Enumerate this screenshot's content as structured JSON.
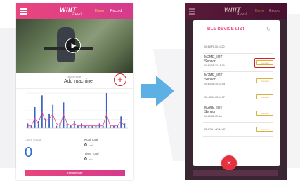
{
  "left_screen": {
    "header": {
      "logo": "WIIIT",
      "logo_sub": "Sport",
      "tab_active": "Home",
      "tab_other": "Record"
    },
    "machine_bar": {
      "label_small": "Device name",
      "label": "Add machine",
      "add_symbol": "+"
    },
    "chart_data": {
      "type": "bar",
      "values": [
        2,
        1,
        9,
        3,
        14,
        4,
        6,
        10,
        1,
        2,
        11,
        2,
        1,
        3,
        1,
        2,
        1,
        1,
        1,
        1,
        2,
        1,
        15,
        1,
        1,
        1,
        5,
        2
      ],
      "line_values": [
        1,
        1,
        4,
        2,
        7,
        3,
        4,
        6,
        2,
        1,
        6,
        2,
        1,
        2,
        1,
        1,
        1,
        1,
        1,
        1,
        1,
        1,
        6,
        1,
        1,
        1,
        3,
        1
      ],
      "colors": {
        "bar": "#3a63c8",
        "line": "#e8467f",
        "grid": "#e6e6e6"
      }
    },
    "stats": {
      "left_title": "Count TOTAL",
      "left_value": "0",
      "right_title_1": "Kcal Total",
      "right_value_1": "0",
      "right_unit_1": "kcal",
      "right_title_2": "Time Total",
      "right_value_2": "0",
      "right_unit_2": "min"
    },
    "bottom_button": "Exercise Start"
  },
  "right_screen": {
    "header": {
      "logo": "WIIIT",
      "logo_sub": "Sport",
      "tab_active": "Home",
      "tab_other": "Record"
    },
    "dialog_title": "BLE DEVICE LIST",
    "refresh_symbol": "↻",
    "devices": [
      {
        "kind": "single",
        "mac": "00:60:F0:70:10:20"
      },
      {
        "kind": "multi",
        "name1": "M2ME_IOT",
        "name2": "Sensor",
        "mac": "00:60:0E:32:15:7A",
        "button": "Connect",
        "highlighted": true
      },
      {
        "kind": "multi",
        "name1": "M2ME_IOT",
        "name2": "Sensor",
        "mac": "00:60:0E:30:D2:08",
        "button": "Connect"
      },
      {
        "kind": "single",
        "mac": "C0:00:00:03:04:0F",
        "button": "Connect"
      },
      {
        "kind": "multi",
        "name1": "M2ME_IOT",
        "name2": "Sensor",
        "mac": "00:60:0E:15:DA",
        "button": "Connect"
      },
      {
        "kind": "single",
        "mac": "0F:67:AA:00:44:0F",
        "button": "Connect"
      }
    ],
    "fab_symbol": "×"
  },
  "arrow_color": "#5db0e4"
}
